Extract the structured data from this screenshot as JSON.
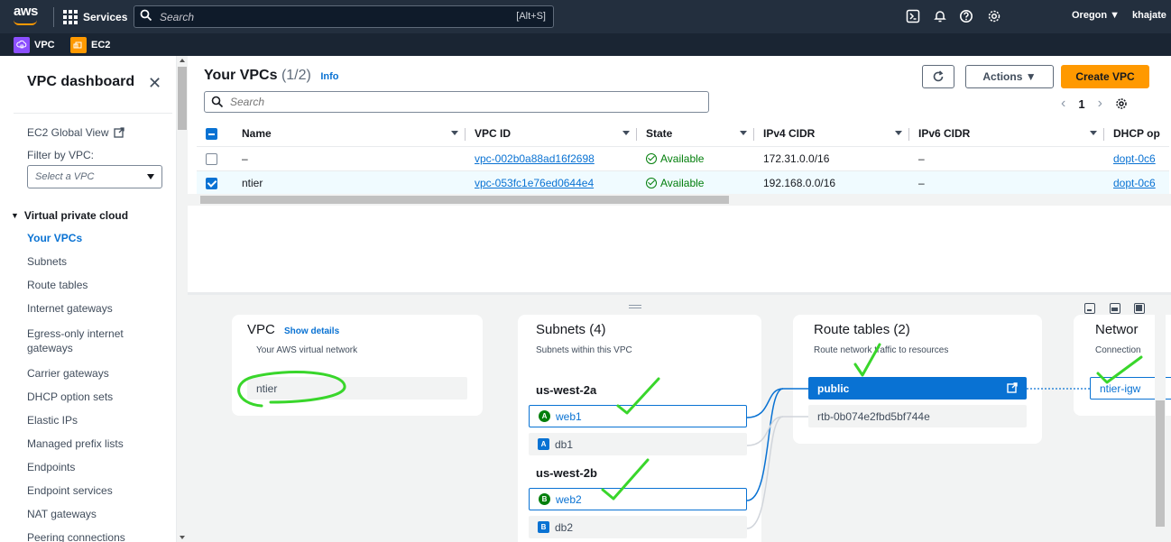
{
  "topnav": {
    "logo": "aws",
    "services_label": "Services",
    "search_placeholder": "Search",
    "search_shortcut": "[Alt+S]",
    "region": "Oregon ▼",
    "user": "khajate"
  },
  "favorites": [
    {
      "label": "VPC",
      "color": "#8c4fff"
    },
    {
      "label": "EC2",
      "color": "#ff9900"
    }
  ],
  "sidebar": {
    "title": "VPC dashboard",
    "global_view": "EC2 Global View",
    "filter_label": "Filter by VPC:",
    "filter_placeholder": "Select a VPC",
    "section": "Virtual private cloud",
    "items": [
      "Your VPCs",
      "Subnets",
      "Route tables",
      "Internet gateways",
      "Egress-only internet gateways",
      "Carrier gateways",
      "DHCP option sets",
      "Elastic IPs",
      "Managed prefix lists",
      "Endpoints",
      "Endpoint services",
      "NAT gateways",
      "Peering connections"
    ],
    "active_item": "Your VPCs"
  },
  "main": {
    "title": "Your VPCs",
    "count": "(1/2)",
    "info": "Info",
    "actions_label": "Actions ▼",
    "create_label": "Create VPC",
    "search_placeholder": "Search",
    "page": "1",
    "columns": [
      "Name",
      "VPC ID",
      "State",
      "IPv4 CIDR",
      "IPv6 CIDR",
      "DHCP op"
    ],
    "rows": [
      {
        "name": "–",
        "vpc_id": "vpc-002b0a88ad16f2698",
        "state": "Available",
        "ipv4": "172.31.0.0/16",
        "ipv6": "–",
        "dhcp": "dopt-0c6",
        "selected": false
      },
      {
        "name": "ntier",
        "vpc_id": "vpc-053fc1e76ed0644e4",
        "state": "Available",
        "ipv4": "192.168.0.0/16",
        "ipv6": "–",
        "dhcp": "dopt-0c6",
        "selected": true
      }
    ]
  },
  "resource_map": {
    "vpc": {
      "title": "VPC",
      "show_details": "Show details",
      "subtitle": "Your AWS virtual network",
      "node": "ntier"
    },
    "subnets": {
      "title": "Subnets (4)",
      "subtitle": "Subnets within this VPC",
      "az1": "us-west-2a",
      "az1_subnets": [
        {
          "label": "web1",
          "badge": "A"
        },
        {
          "label": "db1",
          "badge": "A"
        }
      ],
      "az2": "us-west-2b",
      "az2_subnets": [
        {
          "label": "web2",
          "badge": "B"
        },
        {
          "label": "db2",
          "badge": "B"
        }
      ]
    },
    "route_tables": {
      "title": "Route tables (2)",
      "subtitle": "Route network traffic to resources",
      "items": [
        "public",
        "rtb-0b074e2fbd5bf744e"
      ]
    },
    "network": {
      "title": "Networ",
      "subtitle": "Connection",
      "item": "ntier-igw"
    }
  }
}
